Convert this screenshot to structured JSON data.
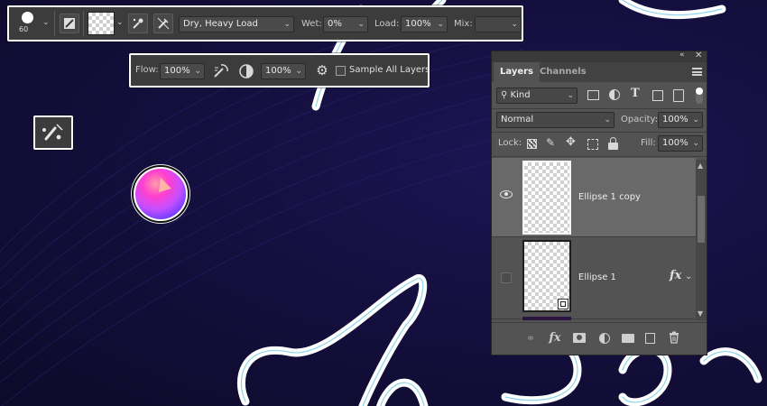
{
  "options_bar": {
    "brush_size": "60",
    "brush_preset": "Dry, Heavy Load",
    "wet_label": "Wet:",
    "wet_value": "0%",
    "load_label": "Load:",
    "load_value": "100%",
    "mix_label": "Mix:",
    "mix_value": ""
  },
  "options_bar2": {
    "flow_label": "Flow:",
    "flow_value": "100%",
    "smoothing_value": "100%",
    "sample_all_layers_label": "Sample All Layers"
  },
  "layers_panel": {
    "tabs": [
      {
        "label": "Layers"
      },
      {
        "label": "Channels"
      }
    ],
    "filter_kind": "Kind",
    "blend_mode": "Normal",
    "opacity_label": "Opacity:",
    "opacity_value": "100%",
    "lock_label": "Lock:",
    "fill_label": "Fill:",
    "fill_value": "100%",
    "layers": [
      {
        "name": "Ellipse 1 copy",
        "visible": true,
        "selected": true
      },
      {
        "name": "Ellipse 1",
        "visible": false,
        "selected": false,
        "fx": "fx"
      }
    ]
  },
  "colors": {
    "canvas_bg": "#140f3e",
    "panel_bg": "#535353",
    "selected_row": "#696969",
    "stroke_outline": "#8fd6e8",
    "swatch_pink": "#ff3fd0",
    "swatch_purple": "#6a3cff"
  }
}
